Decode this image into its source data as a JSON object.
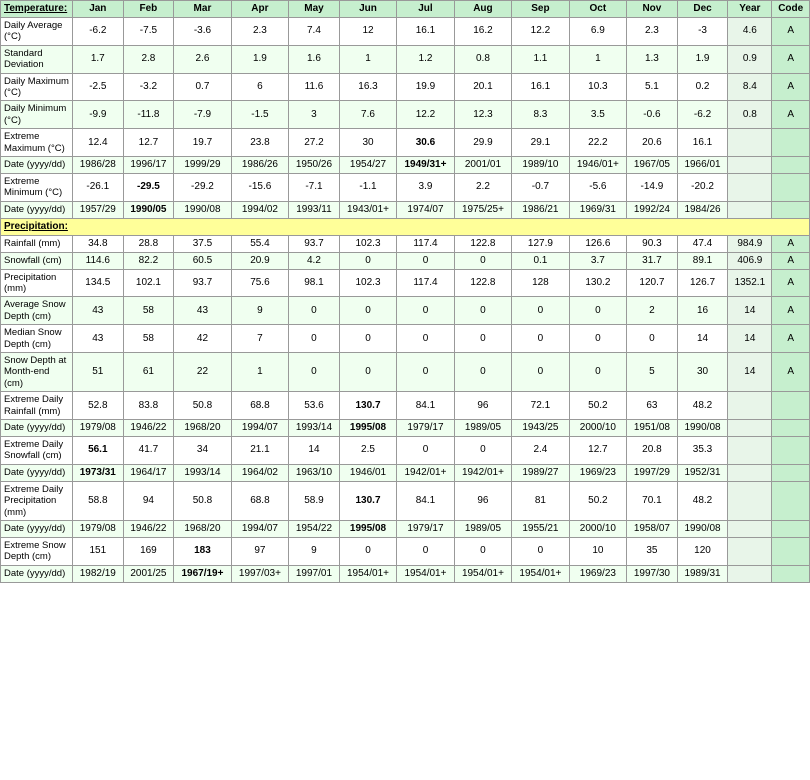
{
  "headers": {
    "label": "Temperature:",
    "cols": [
      "Jan",
      "Feb",
      "Mar",
      "Apr",
      "May",
      "Jun",
      "Jul",
      "Aug",
      "Sep",
      "Oct",
      "Nov",
      "Dec",
      "Year",
      "Code"
    ]
  },
  "rows": [
    {
      "label": "Daily Average (°C)",
      "values": [
        "-6.2",
        "-7.5",
        "-3.6",
        "2.3",
        "7.4",
        "12",
        "16.1",
        "16.2",
        "12.2",
        "6.9",
        "2.3",
        "-3",
        "4.6",
        "A"
      ],
      "bold_cols": [],
      "section": "temperature"
    },
    {
      "label": "Standard Deviation",
      "values": [
        "1.7",
        "2.8",
        "2.6",
        "1.9",
        "1.6",
        "1",
        "1.2",
        "0.8",
        "1.1",
        "1",
        "1.3",
        "1.9",
        "0.9",
        "A"
      ],
      "bold_cols": [],
      "section": "temperature"
    },
    {
      "label": "Daily Maximum (°C)",
      "values": [
        "-2.5",
        "-3.2",
        "0.7",
        "6",
        "11.6",
        "16.3",
        "19.9",
        "20.1",
        "16.1",
        "10.3",
        "5.1",
        "0.2",
        "8.4",
        "A"
      ],
      "bold_cols": [],
      "section": "temperature"
    },
    {
      "label": "Daily Minimum (°C)",
      "values": [
        "-9.9",
        "-11.8",
        "-7.9",
        "-1.5",
        "3",
        "7.6",
        "12.2",
        "12.3",
        "8.3",
        "3.5",
        "-0.6",
        "-6.2",
        "0.8",
        "A"
      ],
      "bold_cols": [],
      "section": "temperature"
    },
    {
      "label": "Extreme Maximum (°C)",
      "values": [
        "12.4",
        "12.7",
        "19.7",
        "23.8",
        "27.2",
        "30",
        "30.6",
        "29.9",
        "29.1",
        "22.2",
        "20.6",
        "16.1",
        "",
        ""
      ],
      "bold_cols": [
        6
      ],
      "section": "temperature"
    },
    {
      "label": "Date (yyyy/dd)",
      "values": [
        "1986/28",
        "1996/17",
        "1999/29",
        "1986/26",
        "1950/26",
        "1954/27",
        "1949/31+",
        "2001/01",
        "1989/10",
        "1946/01+",
        "1967/05",
        "1966/01",
        "",
        ""
      ],
      "bold_cols": [
        6
      ],
      "section": "temperature"
    },
    {
      "label": "Extreme Minimum (°C)",
      "values": [
        "-26.1",
        "-29.5",
        "-29.2",
        "-15.6",
        "-7.1",
        "-1.1",
        "3.9",
        "2.2",
        "-0.7",
        "-5.6",
        "-14.9",
        "-20.2",
        "",
        ""
      ],
      "bold_cols": [
        1
      ],
      "section": "temperature"
    },
    {
      "label": "Date (yyyy/dd)",
      "values": [
        "1957/29",
        "1990/05",
        "1990/08",
        "1994/02",
        "1993/11",
        "1943/01+",
        "1974/07",
        "1975/25+",
        "1986/21",
        "1969/31",
        "1992/24",
        "1984/26",
        "",
        ""
      ],
      "bold_cols": [
        1
      ],
      "section": "temperature"
    },
    {
      "label": "SECTION:Precipitation:",
      "values": [],
      "bold_cols": [],
      "section": "section_header"
    },
    {
      "label": "Rainfall (mm)",
      "values": [
        "34.8",
        "28.8",
        "37.5",
        "55.4",
        "93.7",
        "102.3",
        "117.4",
        "122.8",
        "127.9",
        "126.6",
        "90.3",
        "47.4",
        "984.9",
        "A"
      ],
      "bold_cols": [],
      "section": "precipitation"
    },
    {
      "label": "Snowfall (cm)",
      "values": [
        "114.6",
        "82.2",
        "60.5",
        "20.9",
        "4.2",
        "0",
        "0",
        "0",
        "0.1",
        "3.7",
        "31.7",
        "89.1",
        "406.9",
        "A"
      ],
      "bold_cols": [],
      "section": "precipitation"
    },
    {
      "label": "Precipitation (mm)",
      "values": [
        "134.5",
        "102.1",
        "93.7",
        "75.6",
        "98.1",
        "102.3",
        "117.4",
        "122.8",
        "128",
        "130.2",
        "120.7",
        "126.7",
        "1352.1",
        "A"
      ],
      "bold_cols": [],
      "section": "precipitation"
    },
    {
      "label": "Average Snow Depth (cm)",
      "values": [
        "43",
        "58",
        "43",
        "9",
        "0",
        "0",
        "0",
        "0",
        "0",
        "0",
        "2",
        "16",
        "14",
        "A"
      ],
      "bold_cols": [],
      "section": "precipitation"
    },
    {
      "label": "Median Snow Depth (cm)",
      "values": [
        "43",
        "58",
        "42",
        "7",
        "0",
        "0",
        "0",
        "0",
        "0",
        "0",
        "0",
        "14",
        "14",
        "A"
      ],
      "bold_cols": [],
      "section": "precipitation"
    },
    {
      "label": "Snow Depth at Month-end (cm)",
      "values": [
        "51",
        "61",
        "22",
        "1",
        "0",
        "0",
        "0",
        "0",
        "0",
        "0",
        "5",
        "30",
        "14",
        "A"
      ],
      "bold_cols": [],
      "section": "precipitation"
    },
    {
      "label": "Extreme Daily Rainfall (mm)",
      "values": [
        "52.8",
        "83.8",
        "50.8",
        "68.8",
        "53.6",
        "130.7",
        "84.1",
        "96",
        "72.1",
        "50.2",
        "63",
        "48.2",
        "",
        ""
      ],
      "bold_cols": [
        5
      ],
      "section": "precipitation"
    },
    {
      "label": "Date (yyyy/dd)",
      "values": [
        "1979/08",
        "1946/22",
        "1968/20",
        "1994/07",
        "1993/14",
        "1995/08",
        "1979/17",
        "1989/05",
        "1943/25",
        "2000/10",
        "1951/08",
        "1990/08",
        "",
        ""
      ],
      "bold_cols": [
        5
      ],
      "section": "precipitation"
    },
    {
      "label": "Extreme Daily Snowfall (cm)",
      "values": [
        "56.1",
        "41.7",
        "34",
        "21.1",
        "14",
        "2.5",
        "0",
        "0",
        "2.4",
        "12.7",
        "20.8",
        "35.3",
        "",
        ""
      ],
      "bold_cols": [
        0
      ],
      "section": "precipitation"
    },
    {
      "label": "Date (yyyy/dd)",
      "values": [
        "1973/31",
        "1964/17",
        "1993/14",
        "1964/02",
        "1963/10",
        "1946/01",
        "1942/01+",
        "1942/01+",
        "1989/27",
        "1969/23",
        "1997/29",
        "1952/31",
        "",
        ""
      ],
      "bold_cols": [
        0
      ],
      "section": "precipitation"
    },
    {
      "label": "Extreme Daily Precipitation (mm)",
      "values": [
        "58.8",
        "94",
        "50.8",
        "68.8",
        "58.9",
        "130.7",
        "84.1",
        "96",
        "81",
        "50.2",
        "70.1",
        "48.2",
        "",
        ""
      ],
      "bold_cols": [
        5
      ],
      "section": "precipitation"
    },
    {
      "label": "Date (yyyy/dd)",
      "values": [
        "1979/08",
        "1946/22",
        "1968/20",
        "1994/07",
        "1954/22",
        "1995/08",
        "1979/17",
        "1989/05",
        "1955/21",
        "2000/10",
        "1958/07",
        "1990/08",
        "",
        ""
      ],
      "bold_cols": [
        5
      ],
      "section": "precipitation"
    },
    {
      "label": "Extreme Snow Depth (cm)",
      "values": [
        "151",
        "169",
        "183",
        "97",
        "9",
        "0",
        "0",
        "0",
        "0",
        "10",
        "35",
        "120",
        "",
        ""
      ],
      "bold_cols": [
        2
      ],
      "section": "precipitation"
    },
    {
      "label": "Date (yyyy/dd)",
      "values": [
        "1982/19",
        "2001/25",
        "1967/19+",
        "1997/03+",
        "1997/01",
        "1954/01+",
        "1954/01+",
        "1954/01+",
        "1954/01+",
        "1969/23",
        "1997/30",
        "1989/31",
        "",
        ""
      ],
      "bold_cols": [
        2
      ],
      "section": "precipitation"
    }
  ]
}
